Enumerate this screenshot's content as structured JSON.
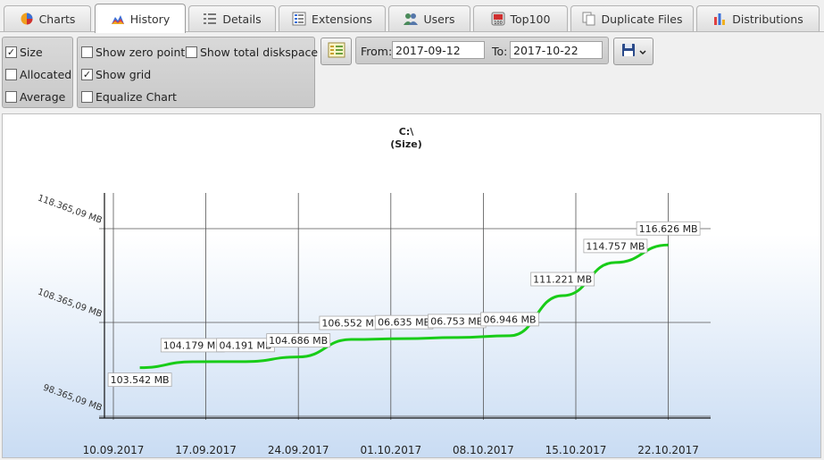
{
  "tabs": [
    {
      "label": "Charts",
      "icon": "pie-chart-icon"
    },
    {
      "label": "History",
      "icon": "mountain-chart-icon",
      "active": true
    },
    {
      "label": "Details",
      "icon": "details-list-icon"
    },
    {
      "label": "Extensions",
      "icon": "extensions-list-icon"
    },
    {
      "label": "Users",
      "icon": "users-icon"
    },
    {
      "label": "Top100",
      "icon": "top100-icon"
    },
    {
      "label": "Duplicate Files",
      "icon": "duplicate-files-icon"
    },
    {
      "label": "Distributions",
      "icon": "bar-chart-icon"
    }
  ],
  "options": {
    "size": {
      "label": "Size",
      "checked": true
    },
    "allocated": {
      "label": "Allocated",
      "checked": false
    },
    "average": {
      "label": "Average",
      "checked": false
    },
    "show_zero_point": {
      "label": "Show zero point",
      "checked": false
    },
    "show_total_diskspace": {
      "label": "Show total diskspace",
      "checked": false
    },
    "show_grid": {
      "label": "Show grid",
      "checked": true
    },
    "equalize_chart": {
      "label": "Equalize Chart",
      "checked": false
    }
  },
  "daterange": {
    "from_label": "From:",
    "from_value": "2017-09-12",
    "to_label": "To:",
    "to_value": "2017-10-22"
  },
  "colors": {
    "line": "#18cc18",
    "accent_blue": "#c9dcf3"
  },
  "chart_data": {
    "type": "line",
    "title": "C:\\",
    "subtitle": "(Size)",
    "y_unit": "MB",
    "y_ticks": [
      98365.09,
      108365.09,
      118365.09
    ],
    "y_tick_labels": [
      "98.365,09 MB",
      "108.365,09 MB",
      "118.365,09 MB"
    ],
    "ylim": [
      98365.09,
      118365.09
    ],
    "x_tick_labels": [
      "10.09.2017",
      "17.09.2017",
      "24.09.2017",
      "01.10.2017",
      "08.10.2017",
      "15.10.2017",
      "22.10.2017"
    ],
    "grid": true,
    "series": [
      {
        "dates": [
          "2017-09-12",
          "2017-09-16",
          "2017-09-20",
          "2017-09-24",
          "2017-09-28",
          "2017-10-02",
          "2017-10-06",
          "2017-10-10",
          "2017-10-14",
          "2017-10-18",
          "2017-10-22"
        ],
        "values": [
          103542,
          104179,
          104191,
          104686,
          106552,
          106635,
          106753,
          106946,
          111221,
          114757,
          116626
        ],
        "labels": [
          "103.542 MB",
          "104.179 MB",
          "04.191 MB",
          "104.686 MB",
          "106.552 MB",
          "06.635 MB",
          "06.753 MB",
          "06.946 MB",
          "111.221 MB",
          "114.757 MB",
          "116.626 MB"
        ]
      }
    ]
  }
}
